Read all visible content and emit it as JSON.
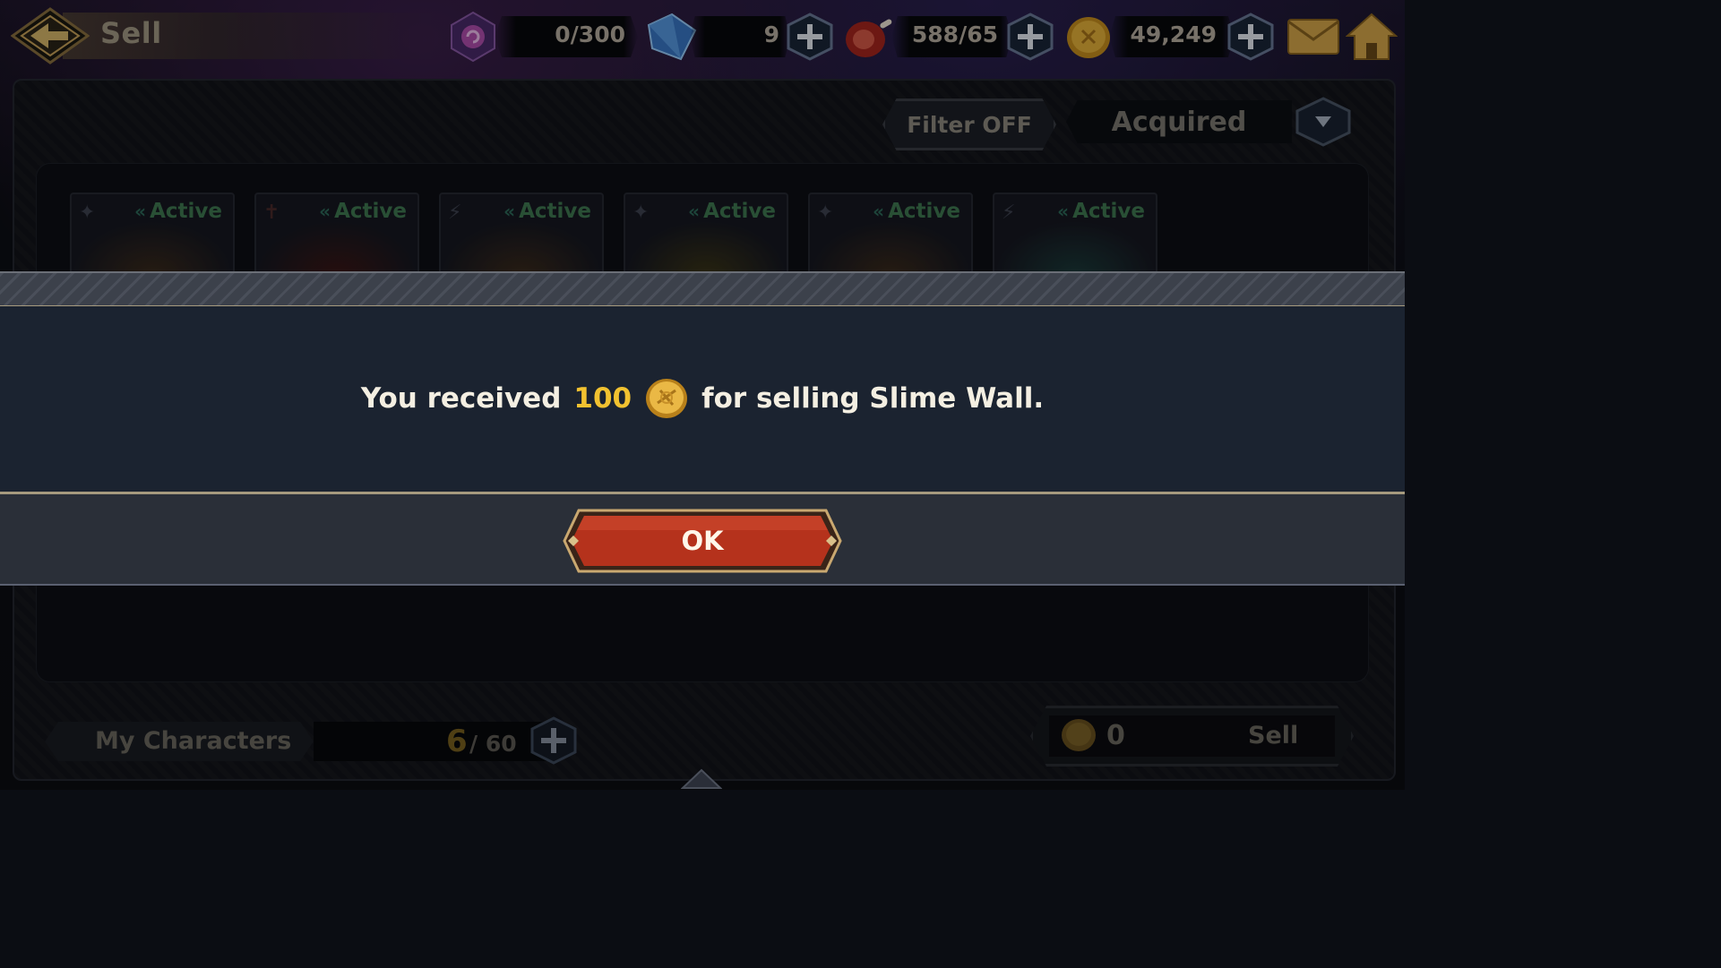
{
  "header": {
    "title": "Sell",
    "resources": [
      {
        "name": "storage",
        "icon": "purple-orb-icon",
        "value": "0/300"
      },
      {
        "name": "gems",
        "icon": "blue-crystal-icon",
        "value": "9"
      },
      {
        "name": "meat",
        "icon": "meat-icon",
        "value": "588/65"
      },
      {
        "name": "gold",
        "icon": "gold-coin-icon",
        "value": "49,249"
      }
    ]
  },
  "toolbar": {
    "filter_label": "Filter OFF",
    "sort_label": "Acquired"
  },
  "characters": [
    {
      "element": "✦",
      "status": "Active"
    },
    {
      "element": "✝",
      "status": "Active"
    },
    {
      "element": "⚡",
      "status": "Active"
    },
    {
      "element": "✦",
      "status": "Active"
    },
    {
      "element": "✦",
      "status": "Active"
    },
    {
      "element": "⚡",
      "status": "Active"
    }
  ],
  "footer": {
    "my_characters_label": "My Characters",
    "count_current": "6",
    "count_max": "/ 60",
    "sell_amount": "0",
    "sell_label": "Sell"
  },
  "modal": {
    "msg_prefix": "You received",
    "msg_amount": "100",
    "msg_suffix": "for selling Slime Wall.",
    "ok_label": "OK"
  },
  "colors": {
    "accent_gold": "#f2c230",
    "ok_button_red": "#b5321c",
    "active_green": "#3f7a52"
  }
}
